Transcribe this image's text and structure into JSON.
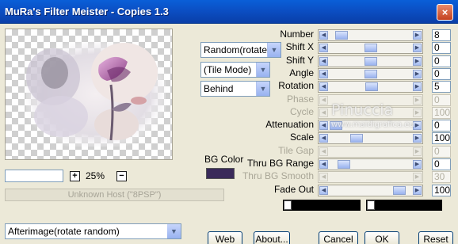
{
  "window": {
    "title": "MuRa's Filter Meister - Copies 1.3",
    "close_label": "×"
  },
  "zoom": {
    "minus": "−",
    "plus": "+",
    "value": "25%",
    "minus_right": "−"
  },
  "status_text": "Unknown Host (\"8PSP\")",
  "combos": {
    "mode": "Random(rotate)",
    "tile": "(Tile Mode)",
    "layer": "Behind",
    "preset": "Afterimage(rotate random)"
  },
  "bg_color": {
    "label": "BG Color",
    "value": "#3a2a5a"
  },
  "params": [
    {
      "name": "Number",
      "value": "8",
      "enabled": true,
      "level": 0.08
    },
    {
      "name": "Shift X",
      "value": "0",
      "enabled": true,
      "level": 0.5
    },
    {
      "name": "Shift Y",
      "value": "0",
      "enabled": true,
      "level": 0.5
    },
    {
      "name": "Angle",
      "value": "0",
      "enabled": true,
      "level": 0.5
    },
    {
      "name": "Rotation",
      "value": "5",
      "enabled": true,
      "level": 0.52
    },
    {
      "name": "Phase",
      "value": "0",
      "enabled": false,
      "level": 0.5
    },
    {
      "name": "Cycle",
      "value": "100",
      "enabled": false,
      "level": 0.95
    },
    {
      "name": "Attenuation",
      "value": "0",
      "enabled": true,
      "level": 0.0
    },
    {
      "name": "Scale",
      "value": "100",
      "enabled": true,
      "level": 0.3
    },
    {
      "name": "Tile Gap",
      "value": "0",
      "enabled": false,
      "level": 0.0
    },
    {
      "name": "Thru BG Range",
      "value": "0",
      "enabled": true,
      "level": 0.12
    },
    {
      "name": "Thru BG Smooth",
      "value": "30",
      "enabled": false,
      "level": 0.12
    },
    {
      "name": "Fade Out",
      "value": "100",
      "enabled": true,
      "level": 0.92
    }
  ],
  "watermark": {
    "name": "Pinuccia",
    "url": "www.maidigrafica.eu"
  },
  "buttons": {
    "web": "Web",
    "about": "About...",
    "cancel": "Cancel",
    "ok": "OK",
    "reset": "Reset"
  }
}
